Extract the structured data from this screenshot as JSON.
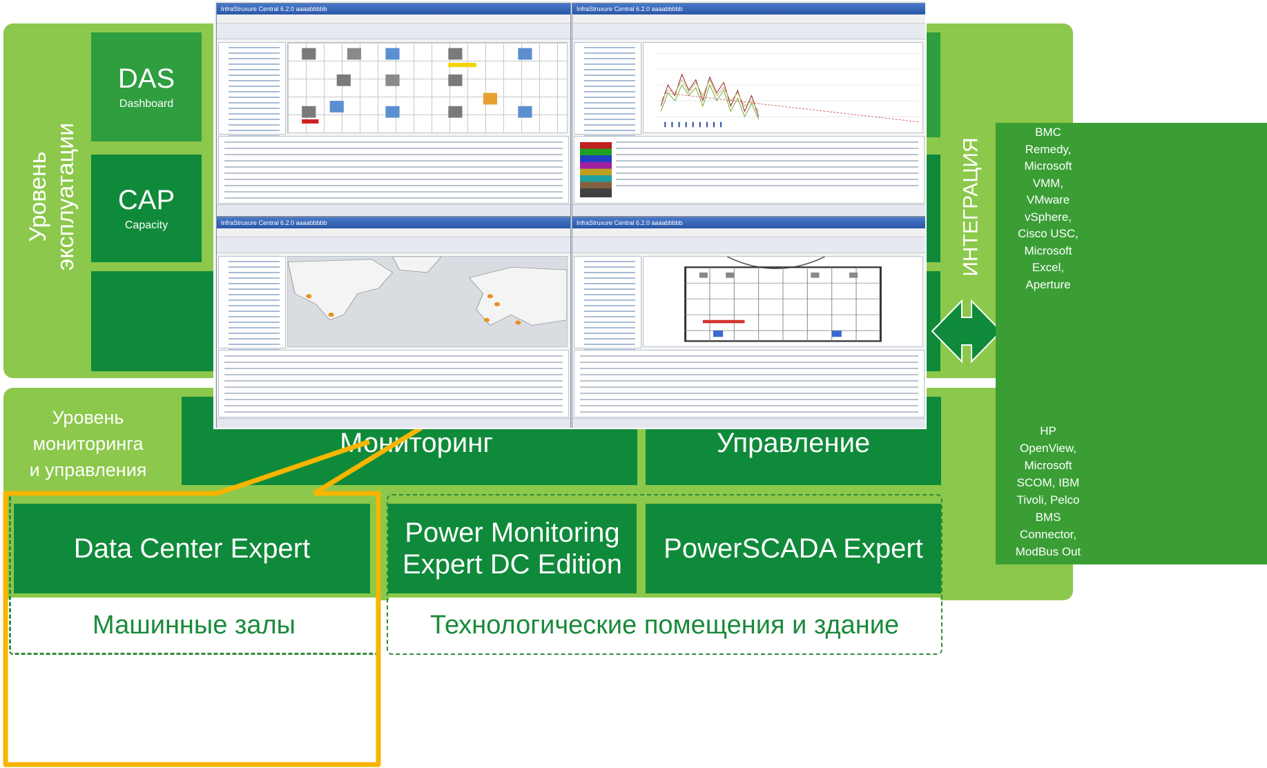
{
  "operations_level": {
    "label": "Уровень эксплуатации",
    "das": {
      "title": "DAS",
      "subtitle": "Dashboard"
    },
    "cap": {
      "title": "CAP",
      "subtitle": "Capacity"
    }
  },
  "monitoring_level": {
    "label_lines": [
      "Уровень",
      "мониторинга",
      "и управления"
    ],
    "monitoring": "Мониторинг",
    "management": "Управление"
  },
  "products": {
    "data_center_expert": "Data Center Expert",
    "power_monitoring_lines": [
      "Power Monitoring",
      "Expert DC Edition"
    ],
    "powerscada": "PowerSCADA Expert"
  },
  "zones": {
    "machine_rooms": "Машинные залы",
    "tech_rooms": "Технологические помещения и здание"
  },
  "integration": {
    "label": "ИНТЕГРАЦИЯ",
    "top_lines": [
      "BMC",
      "Remedy,",
      "Microsoft",
      "VMM,",
      "VMware",
      "vSphere,",
      "Cisco USC,",
      "Microsoft",
      "Excel,",
      "Aperture"
    ],
    "bottom_lines": [
      "HP",
      "OpenView,",
      "Microsoft",
      "SCOM, IBM",
      "Tivoli, Pelco",
      "BMS",
      "Connector,",
      "ModBus Out"
    ]
  },
  "screenshots": {
    "window_title": "InfraStruxure Central 6.2.0  aaaabbbbb"
  },
  "colors": {
    "light_green": "#8cc84b",
    "dark_green": "#0f8a3a",
    "integration_green": "#3a9e35",
    "highlight_orange": "#f7b500",
    "zone_green": "#1a8a3a"
  }
}
